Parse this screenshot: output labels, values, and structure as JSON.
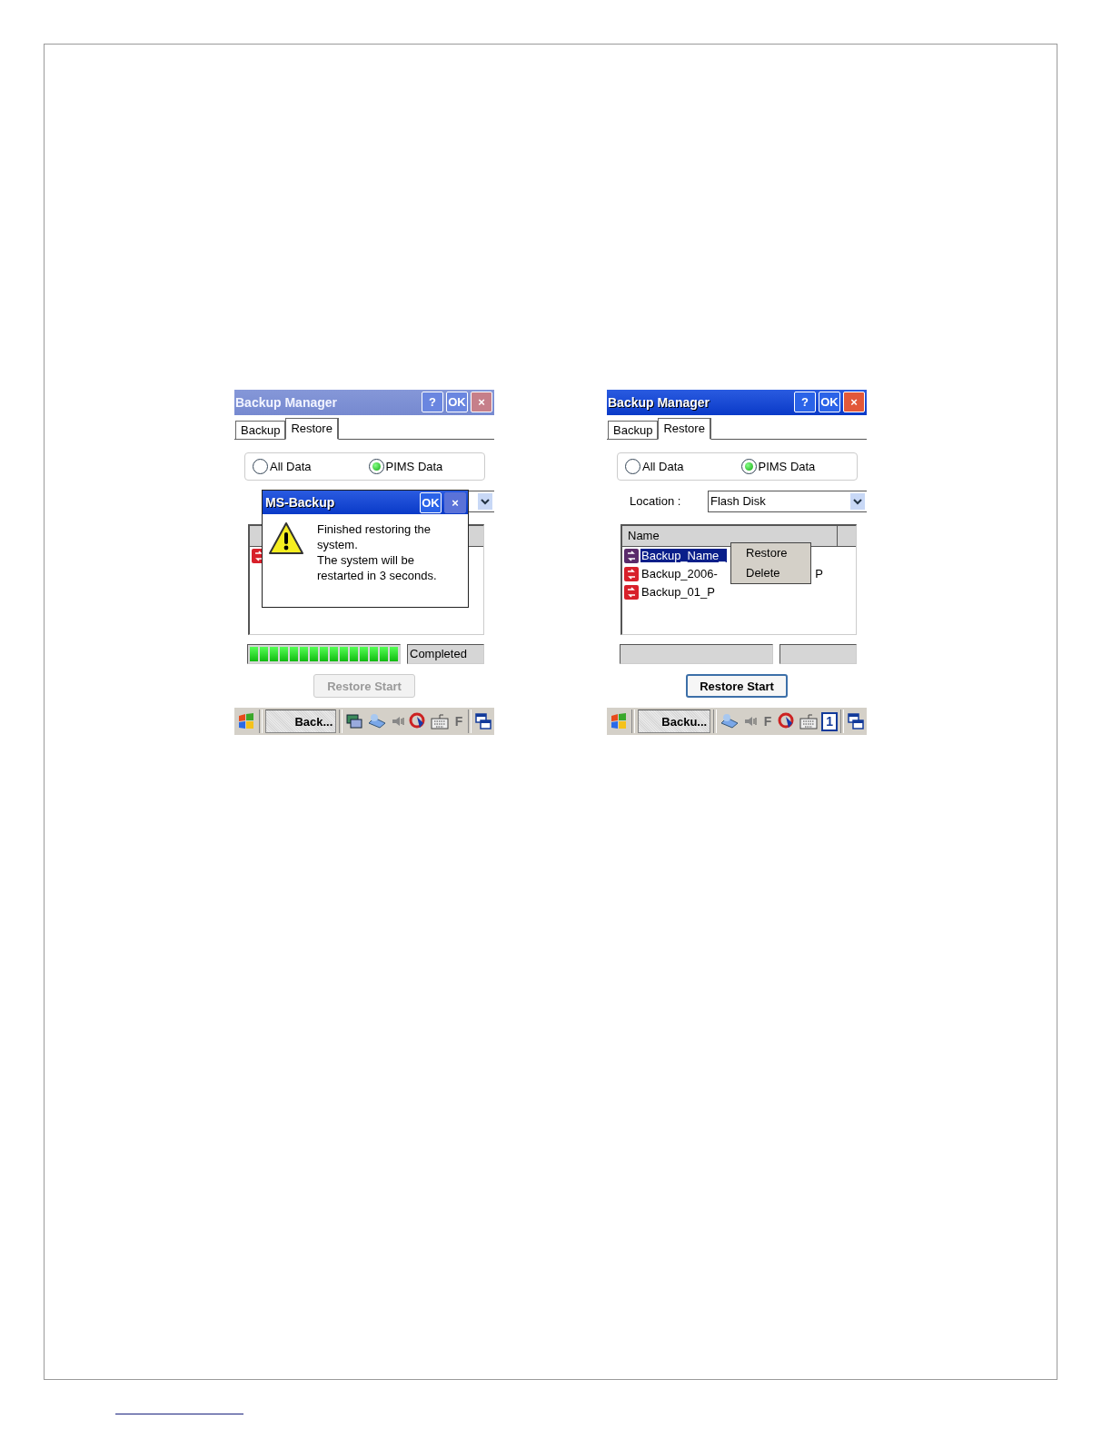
{
  "screens": [
    {
      "title": "Backup Manager",
      "active": false,
      "title_buttons": [
        "?",
        "OK",
        "×"
      ],
      "tabs": [
        {
          "label": "Backup",
          "selected": false
        },
        {
          "label": "Restore",
          "selected": true
        }
      ],
      "radios": [
        {
          "label": "All Data",
          "selected": false
        },
        {
          "label": "PIMS Data",
          "selected": true
        }
      ],
      "list": {
        "rows": [
          {
            "selected": false
          }
        ]
      },
      "progress": {
        "level": 1,
        "status": "Completed"
      },
      "start_button": {
        "label": "Restore Start",
        "disabled": true
      },
      "taskbar": {
        "task": "Back...",
        "tray": [
          {
            "kind": "network"
          },
          {
            "kind": "device"
          },
          {
            "kind": "speaker"
          },
          {
            "kind": "sync"
          },
          {
            "kind": "keyboard"
          },
          {
            "kind": "letter",
            "text": "F"
          }
        ]
      },
      "dialog": {
        "title": "MS-Backup",
        "buttons": [
          "OK",
          "×"
        ],
        "message": "Finished restoring the system.\nThe system will be restarted in 3 seconds."
      }
    },
    {
      "title": "Backup Manager",
      "active": true,
      "title_buttons": [
        "?",
        "OK",
        "×"
      ],
      "tabs": [
        {
          "label": "Backup",
          "selected": false
        },
        {
          "label": "Restore",
          "selected": true
        }
      ],
      "radios": [
        {
          "label": "All Data",
          "selected": false
        },
        {
          "label": "PIMS Data",
          "selected": true
        }
      ],
      "location": {
        "label": "Location :",
        "value": "Flash Disk"
      },
      "list": {
        "header": "Name",
        "rows": [
          {
            "name": "Backup_Name_",
            "selected": true
          },
          {
            "name": "Backup_2006-",
            "name_end": "P",
            "selected": false
          },
          {
            "name": "Backup_01_P",
            "selected": false
          }
        ]
      },
      "progress": {
        "level": 0
      },
      "start_button": {
        "label": "Restore Start",
        "disabled": false
      },
      "taskbar": {
        "task": "Backu...",
        "tray": [
          {
            "kind": "device"
          },
          {
            "kind": "speaker"
          },
          {
            "kind": "letter",
            "text": "F"
          },
          {
            "kind": "sync"
          },
          {
            "kind": "keyboard"
          },
          {
            "kind": "boxed",
            "text": "1"
          }
        ]
      },
      "context_menu": {
        "items": [
          "Restore",
          "Delete"
        ]
      }
    }
  ]
}
